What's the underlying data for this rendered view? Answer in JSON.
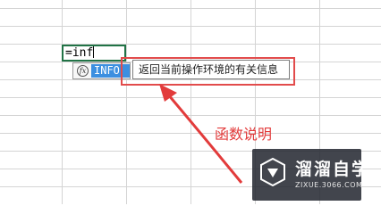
{
  "cell": {
    "formula": "=inf"
  },
  "autocomplete": {
    "icon": "function-icon",
    "icon_glyph": "fx",
    "items": [
      "INFO"
    ]
  },
  "tooltip": {
    "text": "返回当前操作环境的有关信息"
  },
  "annotation": {
    "text": "函数说明",
    "color": "#e23b3b"
  },
  "watermark": {
    "title": "溜溜自学",
    "url": "ZIXUE.3066.COM"
  },
  "colors": {
    "selection_border": "#217346",
    "highlight": "#e24b4b",
    "autocomplete_selected": "#3c8fe0"
  }
}
